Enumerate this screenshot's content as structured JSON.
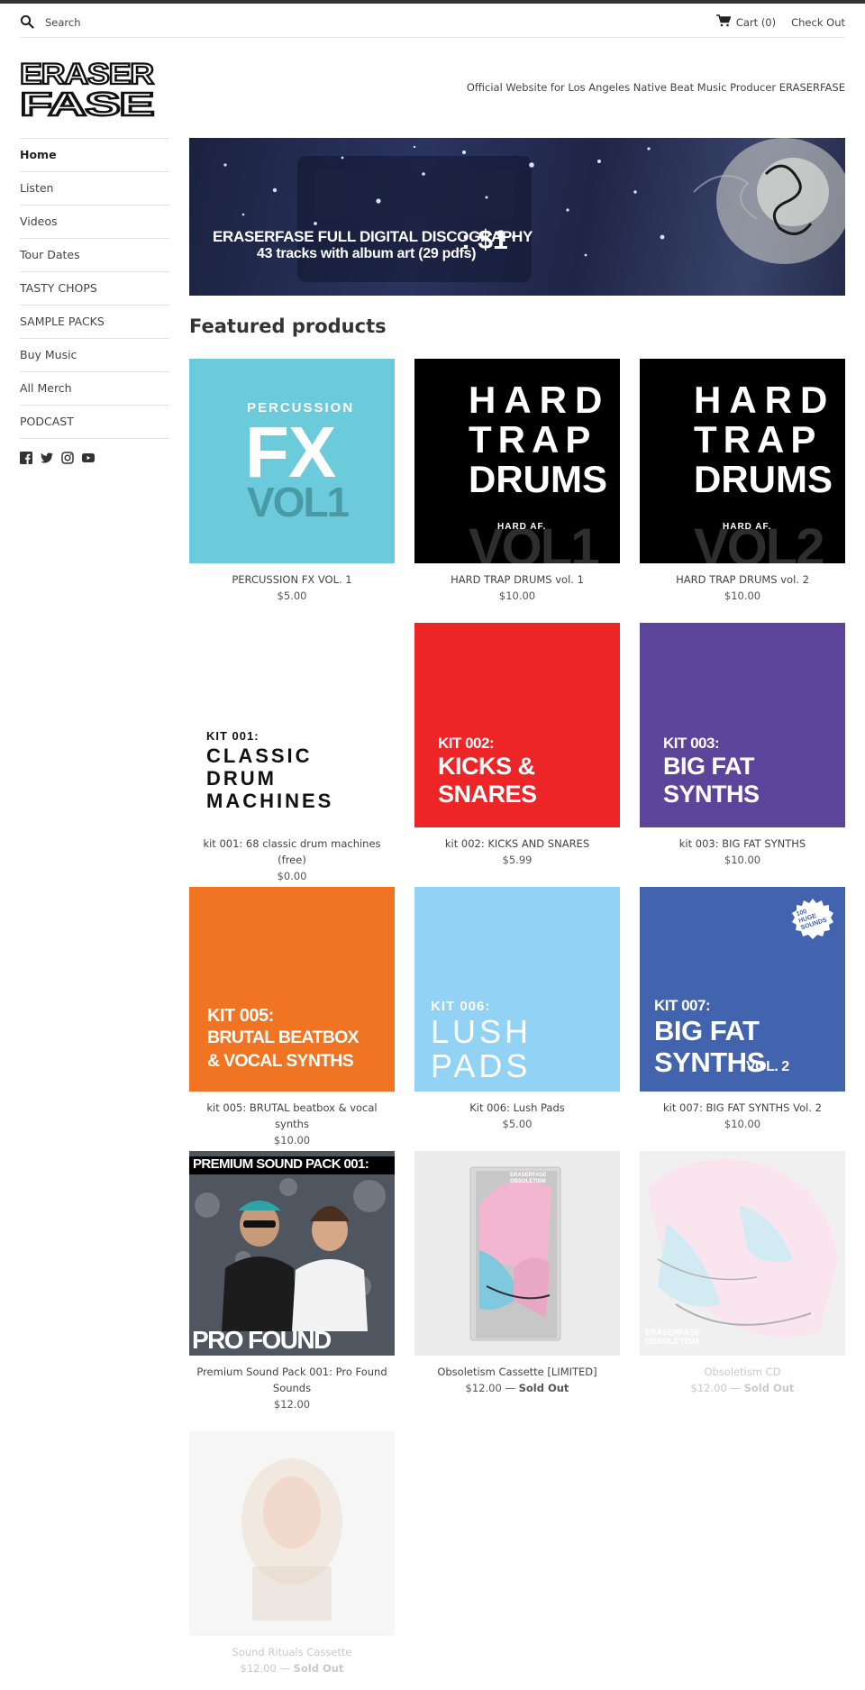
{
  "header": {
    "search_placeholder": "Search",
    "cart_label": "Cart (0)",
    "checkout_label": "Check Out"
  },
  "brand": {
    "logo_line1": "ERASER",
    "logo_line2": "FASE",
    "tagline": "Official Website for Los Angeles Native Beat Music Producer ERASERFASE"
  },
  "sidebar": {
    "items": [
      {
        "label": "Home",
        "active": true
      },
      {
        "label": "Listen"
      },
      {
        "label": "Videos"
      },
      {
        "label": "Tour Dates"
      },
      {
        "label": "TASTY CHOPS"
      },
      {
        "label": "SAMPLE PACKS"
      },
      {
        "label": "Buy Music"
      },
      {
        "label": "All Merch"
      },
      {
        "label": "PODCAST"
      }
    ],
    "social_icons": [
      "facebook-icon",
      "twitter-icon",
      "instagram-icon",
      "youtube-icon"
    ]
  },
  "banner": {
    "line1": "ERASERFASE FULL DIGITAL DISCOGRAPHY",
    "line2": "43 tracks with album art (29 pdfs)",
    "price": ": $1"
  },
  "featured": {
    "title": "Featured products",
    "products": [
      {
        "name": "PERCUSSION FX VOL. 1",
        "price": "$5.00",
        "art": {
          "bg": "#6ccbdb",
          "small": "PERCUSSION",
          "big": "FX",
          "vol": "VOL1"
        }
      },
      {
        "name": "HARD TRAP DRUMS vol. 1",
        "price": "$10.00",
        "art": {
          "bg": "#000000",
          "lines": [
            "HARD",
            "TRAP",
            "DRUMS"
          ],
          "tag": "HARD AF.",
          "vol": "VOL1"
        }
      },
      {
        "name": "HARD TRAP DRUMS vol. 2",
        "price": "$10.00",
        "art": {
          "bg": "#000000",
          "lines": [
            "HARD",
            "TRAP",
            "DRUMS"
          ],
          "tag": "HARD AF.",
          "vol": "VOL2"
        }
      },
      {
        "name": "kit 001: 68 classic drum machines (free)",
        "price": "$0.00",
        "art": {
          "bg": "#ffffff",
          "kit": "KIT 001:",
          "lines": [
            "CLASSIC",
            "DRUM",
            "MACHINES"
          ]
        }
      },
      {
        "name": "kit 002: KICKS AND SNARES",
        "price": "$5.99",
        "art": {
          "bg": "#ee2527",
          "kit": "KIT 002:",
          "lines": [
            "KICKS &",
            "SNARES"
          ]
        }
      },
      {
        "name": "kit 003: BIG FAT SYNTHS",
        "price": "$10.00",
        "art": {
          "bg": "#5d449b",
          "kit": "KIT 003:",
          "lines": [
            "BIG FAT",
            "SYNTHS"
          ]
        }
      },
      {
        "name": "kit 005: BRUTAL beatbox & vocal synths",
        "price": "$10.00",
        "art": {
          "bg": "#f07421",
          "kit": "KIT 005:",
          "lines": [
            "BRUTAL BEATBOX",
            "& VOCAL SYNTHS"
          ]
        }
      },
      {
        "name": "Kit 006: Lush Pads",
        "price": "$5.00",
        "art": {
          "bg": "#92d3f5",
          "kit": "KIT 006:",
          "lines": [
            "LUSH",
            "PADS"
          ]
        }
      },
      {
        "name": "kit 007: BIG FAT SYNTHS Vol. 2",
        "price": "$10.00",
        "art": {
          "bg": "#4263ad",
          "kit": "KIT 007:",
          "lines": [
            "BIG FAT",
            "SYNTHS"
          ],
          "vol": "VOL. 2",
          "badge": "100 HUGE SOUNDS"
        }
      },
      {
        "name": "Premium Sound Pack 001: Pro Found Sounds",
        "price": "$12.00",
        "art": {
          "bg": "#2b2b2b",
          "top": "PREMIUM SOUND PACK 001:",
          "bottom": "PRO FOUND SOUNDS"
        }
      },
      {
        "name": "Obsoletism Cassette [LIMITED]",
        "price": "$12.00",
        "sold_out": "Sold Out",
        "art": {
          "bg": "#ebebeb",
          "label": "ERASERFASE OBSOLETISM"
        }
      },
      {
        "name": "Obsoletism CD",
        "price": "$12.00",
        "sold_out": "Sold Out",
        "faded": true,
        "art": {
          "bg": "#d9d9d9",
          "label": "ERASERFASE OBSOLETISM"
        }
      },
      {
        "name": "Sound Rituals Cassette",
        "price": "$12.00",
        "sold_out": "Sold Out",
        "faded": true,
        "art": {
          "bg": "#e8e8e8"
        }
      }
    ]
  }
}
